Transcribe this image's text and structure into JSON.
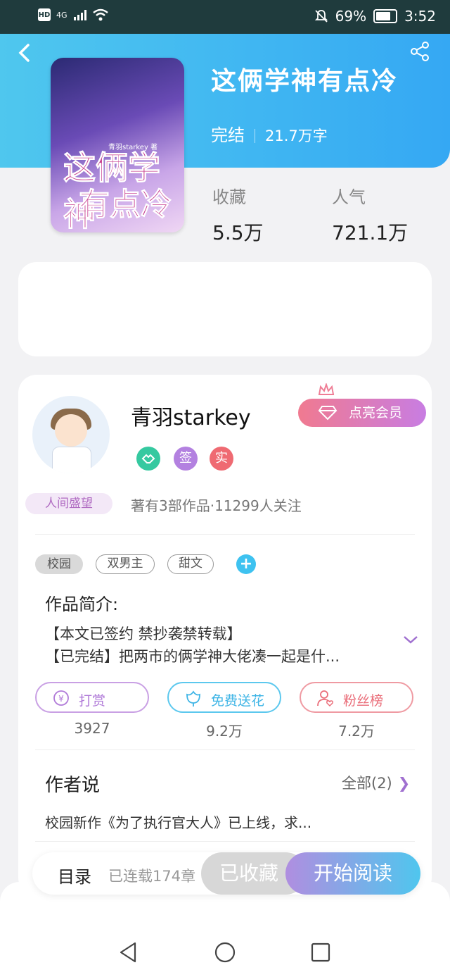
{
  "status_bar": {
    "hd": "HD",
    "network": "4G",
    "battery": "69%",
    "time": "3:52"
  },
  "book": {
    "title": "这俩学神有点冷",
    "status": "完结",
    "word_count": "21.7万字",
    "cover_title_line1": "这俩学神",
    "cover_title_line2": "有点冷",
    "cover_author": "青羽starkey 著"
  },
  "stats": {
    "collect_label": "收藏",
    "collect_value": "5.5万",
    "popularity_label": "人气",
    "popularity_value": "721.1万"
  },
  "author": {
    "name": "青羽starkey",
    "badge": "人间盛望",
    "vip_label": "点亮会员",
    "works_info": "著有3部作品·11299人关注",
    "icon_badges": [
      "签",
      "实"
    ]
  },
  "tags": [
    "校园",
    "双男主",
    "甜文"
  ],
  "intro": {
    "heading": "作品简介:",
    "line1": "【本文已签约 禁抄袭禁转载】",
    "line2": "【已完结】把两市的俩学神大佬凑一起是什..."
  },
  "actions": [
    {
      "label": "打赏",
      "count": "3927"
    },
    {
      "label": "免费送花",
      "count": "9.2万"
    },
    {
      "label": "粉丝榜",
      "count": "7.2万"
    }
  ],
  "author_says": {
    "heading": "作者说",
    "all_label": "全部(2)",
    "content": "校园新作《为了执行官大人》已上线，求..."
  },
  "bottom": {
    "toc": "目录",
    "serial": "已连载174章",
    "collected": "已收藏",
    "read": "开始阅读"
  },
  "colors": {
    "hero": "#3fb5f2",
    "vip_start": "#f07a90",
    "vip_end": "#c87de2",
    "read_start": "#b08ee0",
    "read_end": "#4fc6ee"
  }
}
